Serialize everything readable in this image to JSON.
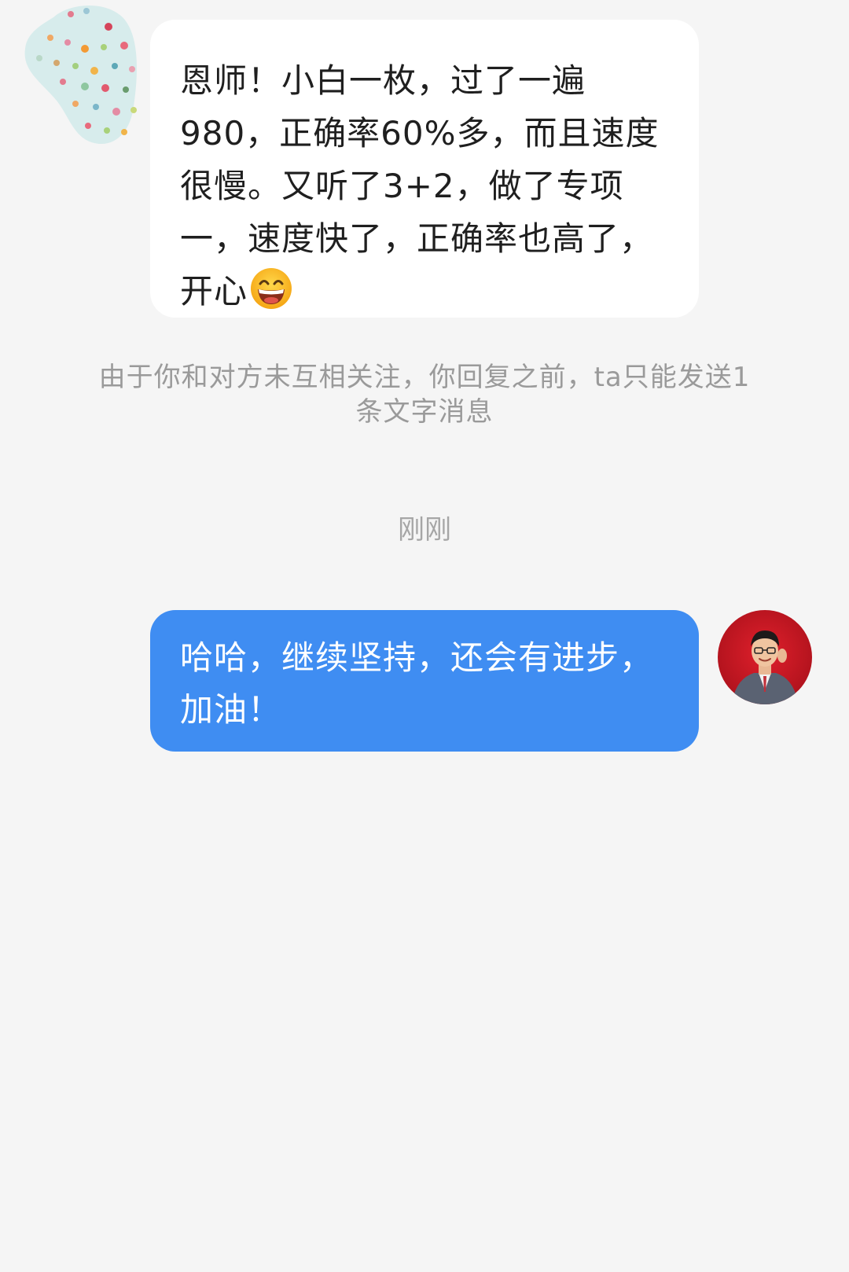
{
  "conversation": {
    "incoming_message": {
      "text": "恩师！小白一枚，过了一遍980，正确率60%多，而且速度很慢。又听了3+2，做了专项一，速度快了，正确率也高了，开心",
      "emoji": "grinning-face-icon",
      "avatar_icon": "polka-dot-avatar-icon"
    },
    "system_notice": "由于你和对方未互相关注，你回复之前，ta只能发送1条文字消息",
    "timestamp": "刚刚",
    "outgoing_message": {
      "text": "哈哈，继续坚持，还会有进步，加油！",
      "avatar_icon": "user-photo-avatar-icon"
    }
  },
  "colors": {
    "background": "#f5f5f5",
    "incoming_bubble": "#ffffff",
    "outgoing_bubble": "#3f8df2",
    "notice_text": "#9a9a9a"
  }
}
